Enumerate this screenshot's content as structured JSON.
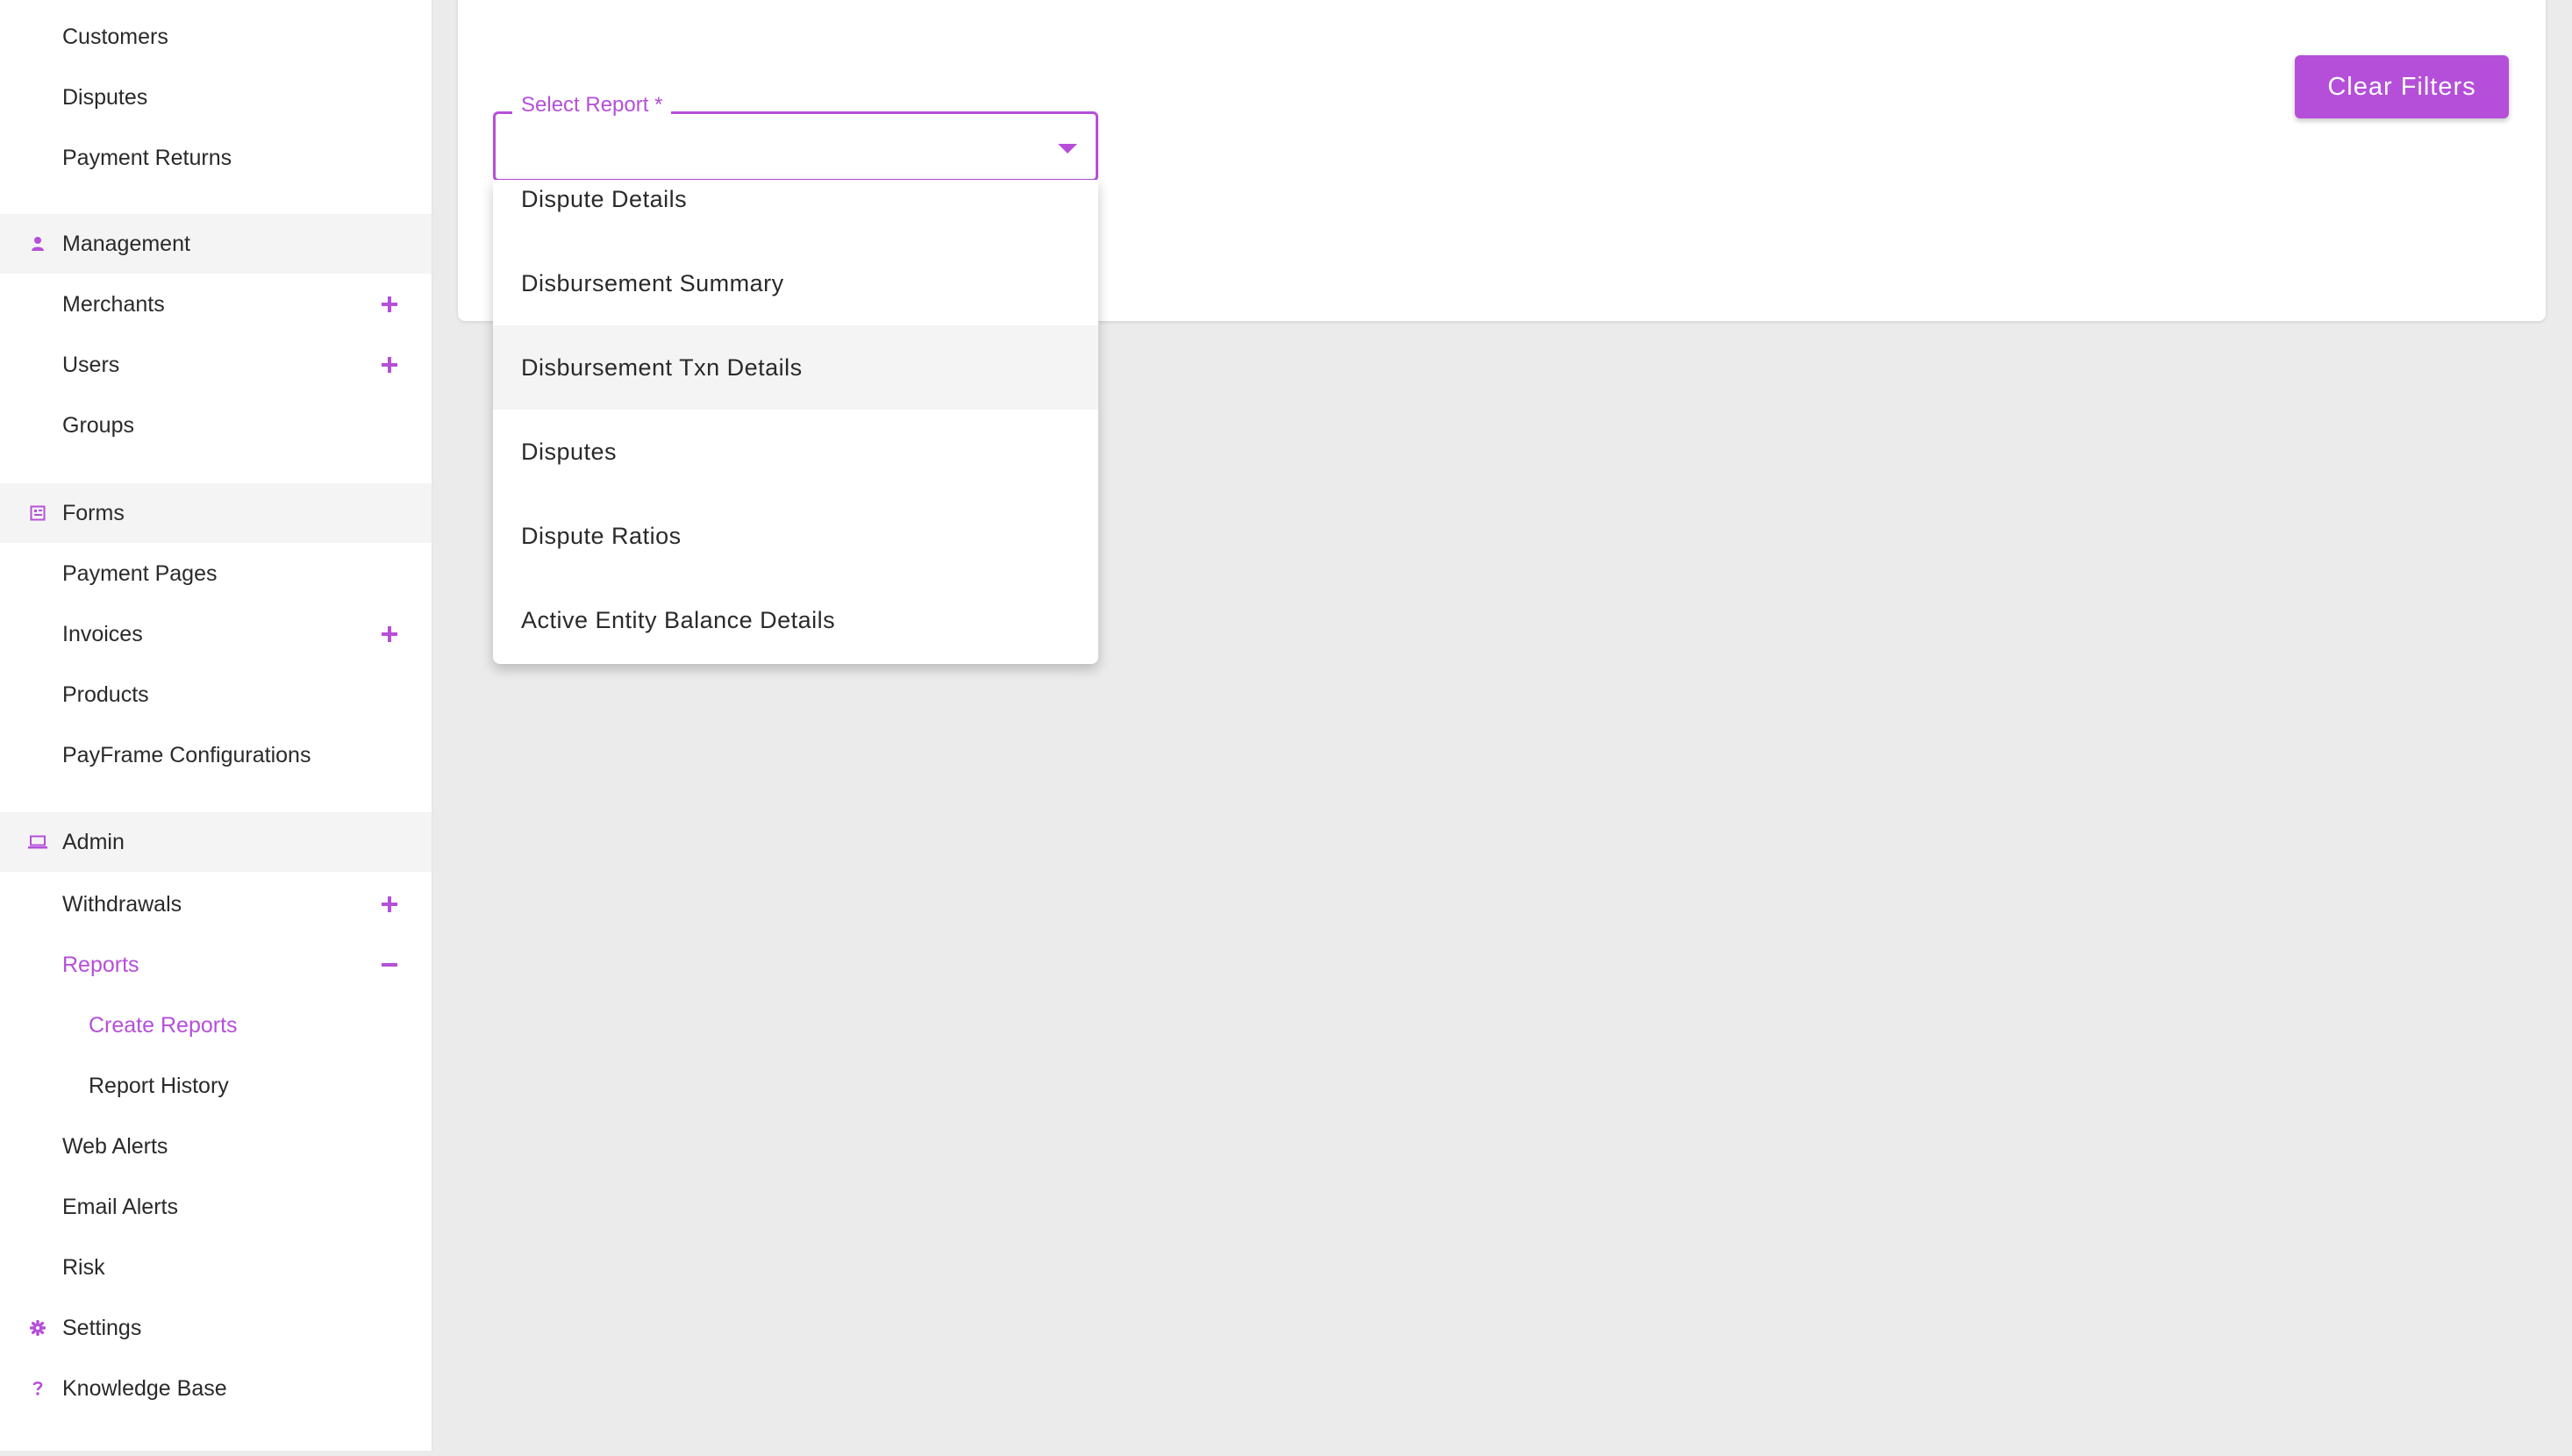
{
  "sidebar": {
    "items": [
      {
        "label": "Customers"
      },
      {
        "label": "Disputes"
      },
      {
        "label": "Payment Returns"
      },
      {
        "label": "Management",
        "icon": "person-icon"
      },
      {
        "label": "Merchants"
      },
      {
        "label": "Users"
      },
      {
        "label": "Groups"
      },
      {
        "label": "Forms",
        "icon": "form-icon"
      },
      {
        "label": "Payment Pages"
      },
      {
        "label": "Invoices"
      },
      {
        "label": "Products"
      },
      {
        "label": "PayFrame Configurations"
      },
      {
        "label": "Admin",
        "icon": "laptop-icon"
      },
      {
        "label": "Withdrawals"
      },
      {
        "label": "Reports",
        "state": "expanded"
      },
      {
        "label": "Create Reports",
        "state": "active"
      },
      {
        "label": "Report History"
      },
      {
        "label": "Web Alerts"
      },
      {
        "label": "Email Alerts"
      },
      {
        "label": "Risk"
      },
      {
        "label": "Settings",
        "icon": "gear-icon"
      },
      {
        "label": "Knowledge Base",
        "icon": "question-icon"
      }
    ]
  },
  "filters": {
    "clear_label": "Clear Filters",
    "select_label": "Select Report *",
    "selected_value": ""
  },
  "dropdown": {
    "options": [
      {
        "label": "Dispute Details"
      },
      {
        "label": "Disbursement Summary"
      },
      {
        "label": "Disbursement Txn Details",
        "state": "hover"
      },
      {
        "label": "Disputes"
      },
      {
        "label": "Dispute Ratios"
      },
      {
        "label": "Active Entity Balance Details"
      }
    ]
  },
  "colors": {
    "accent": "#b54fd9",
    "background": "#ebebeb",
    "section_background": "#f4f4f4"
  }
}
